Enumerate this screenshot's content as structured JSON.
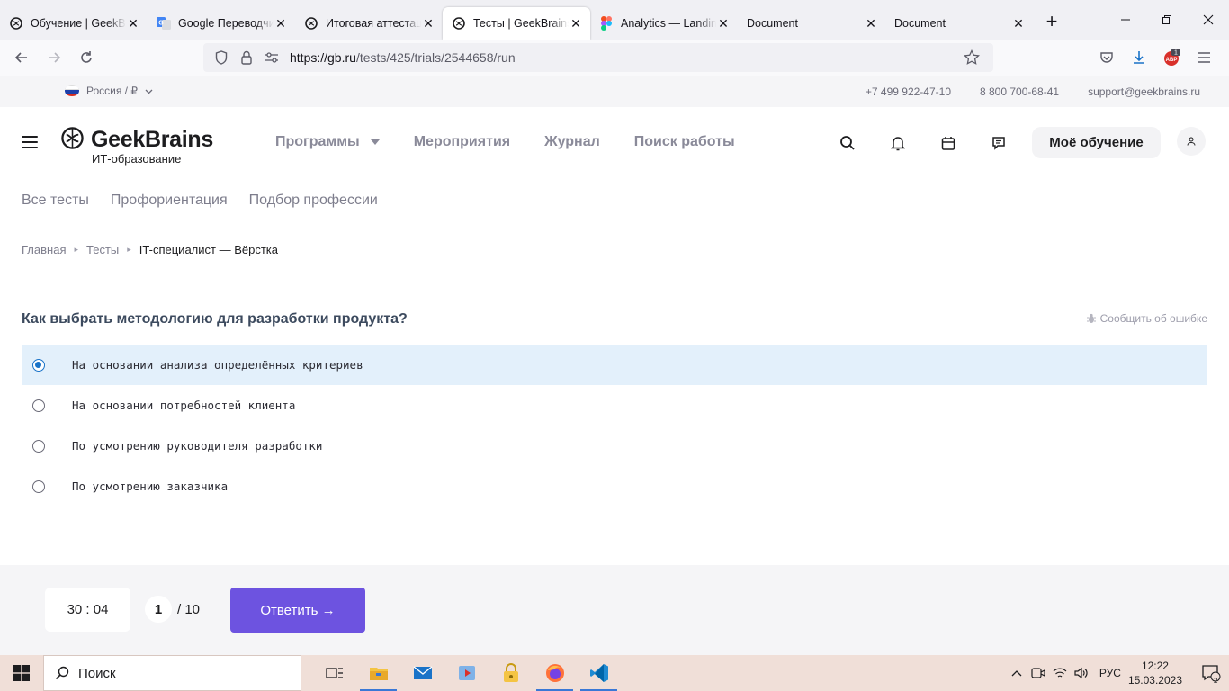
{
  "browser": {
    "tabs": [
      {
        "title": "Обучение | GeekBrains",
        "icon": "geekbrains-icon",
        "active": false
      },
      {
        "title": "Google Переводчик",
        "icon": "google-translate-icon",
        "active": false
      },
      {
        "title": "Итоговая аттестация",
        "icon": "geekbrains-icon",
        "active": false
      },
      {
        "title": "Тесты | GeekBrains -",
        "icon": "geekbrains-icon",
        "active": true
      },
      {
        "title": "Analytics — Landing",
        "icon": "figma-icon",
        "active": false
      },
      {
        "title": "Document",
        "icon": "",
        "active": false
      },
      {
        "title": "Document",
        "icon": "",
        "active": false
      }
    ],
    "url_host": "https://gb.ru",
    "url_path": "/tests/425/trials/2544658/run",
    "abp_badge": "1",
    "abp_label": "ABP"
  },
  "site": {
    "region": "Россия / ₽",
    "phone1": "+7 499 922-47-10",
    "phone2": "8 800 700-68-41",
    "email": "support@geekbrains.ru",
    "logo_name": "GeekBrains",
    "logo_sub": "ИТ-образование",
    "nav": {
      "programs": "Программы",
      "events": "Мероприятия",
      "journal": "Журнал",
      "jobs": "Поиск работы"
    },
    "my_learning": "Моё обучение",
    "subnav": [
      "Все тесты",
      "Профориентация",
      "Подбор профессии"
    ],
    "breadcrumb": [
      "Главная",
      "Тесты",
      "IT-специалист — Вёрстка"
    ]
  },
  "quiz": {
    "question": "Как выбрать методологию для разработки продукта?",
    "report_label": "Сообщить об ошибке",
    "options": [
      {
        "label": "На основании анализа определённых критериев",
        "selected": true
      },
      {
        "label": "На основании потребностей клиента",
        "selected": false
      },
      {
        "label": "По усмотрению руководителя разработки",
        "selected": false
      },
      {
        "label": "По усмотрению заказчика",
        "selected": false
      }
    ],
    "timer": "30 : 04",
    "current": "1",
    "total": "/ 10",
    "answer_button": "Ответить →"
  },
  "taskbar": {
    "search_placeholder": "Поиск",
    "lang": "РУС",
    "time": "12:22",
    "date": "15.03.2023",
    "notifications": "2"
  },
  "colors": {
    "accent": "#6d53e0",
    "selected_bg": "#e3f0fb",
    "radio_selected": "#1a73c8"
  }
}
